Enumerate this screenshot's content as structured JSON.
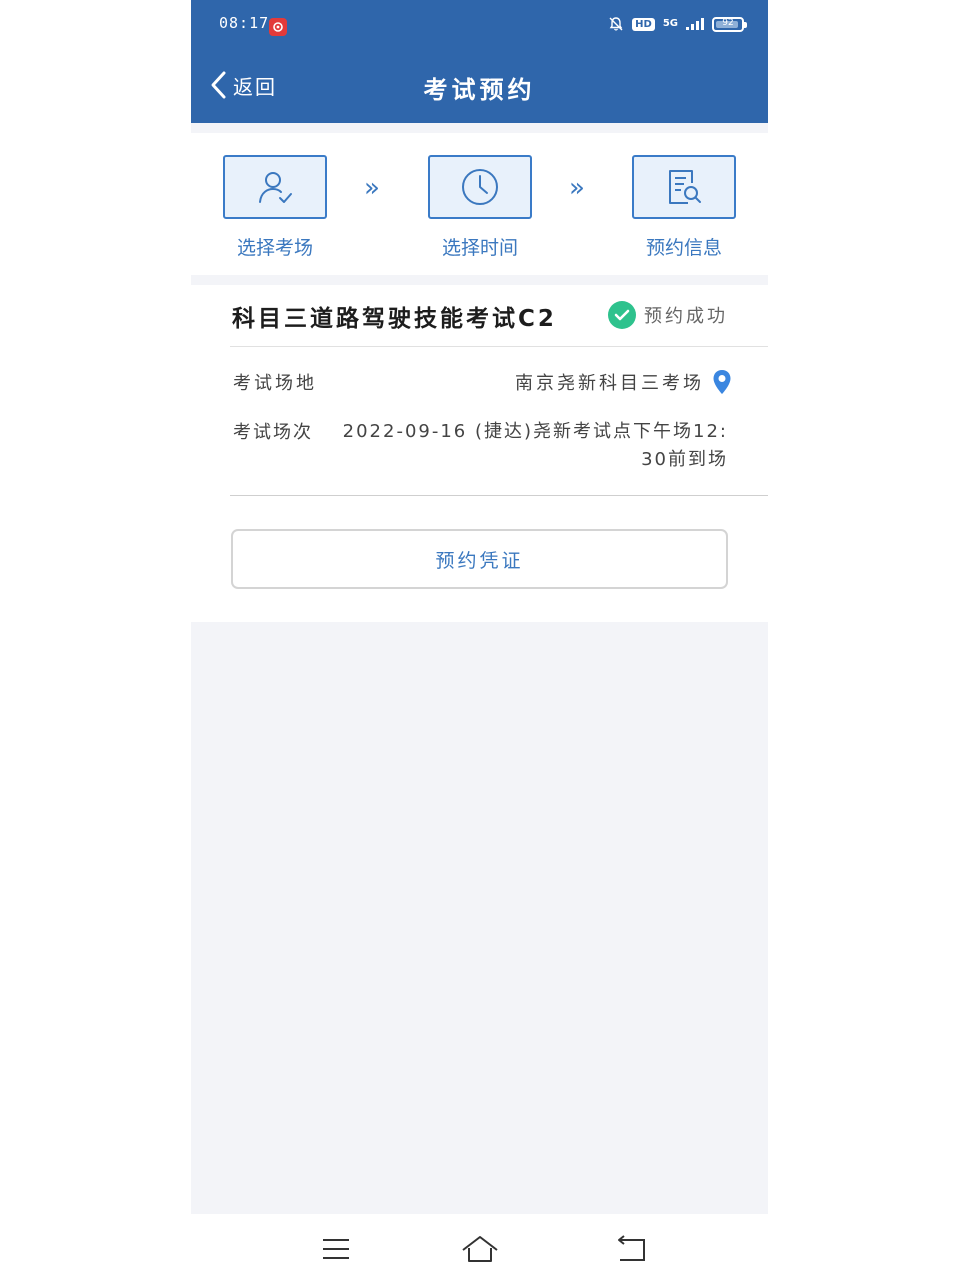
{
  "status_bar": {
    "time": "08:17",
    "network": "5G",
    "battery": "92",
    "battery_level": 0.92
  },
  "header": {
    "back_label": "返回",
    "title": "考试预约"
  },
  "steps": [
    {
      "label": "选择考场",
      "icon": "user-check-icon"
    },
    {
      "label": "选择时间",
      "icon": "clock-icon"
    },
    {
      "label": "预约信息",
      "icon": "document-search-icon"
    }
  ],
  "step_separator": "»",
  "card": {
    "title": "科目三道路驾驶技能考试C2",
    "status": "预约成功",
    "venue_label": "考试场地",
    "venue_value": "南京尧新科目三考场",
    "session_label": "考试场次",
    "session_value": "2022-09-16 (捷达)尧新考试点下午场12: 30前到场",
    "voucher_button": "预约凭证"
  },
  "colors": {
    "header_bg": "#2f66ab",
    "accent": "#3b78bf",
    "success": "#2ec28d",
    "page_bg": "#f3f4f8"
  }
}
